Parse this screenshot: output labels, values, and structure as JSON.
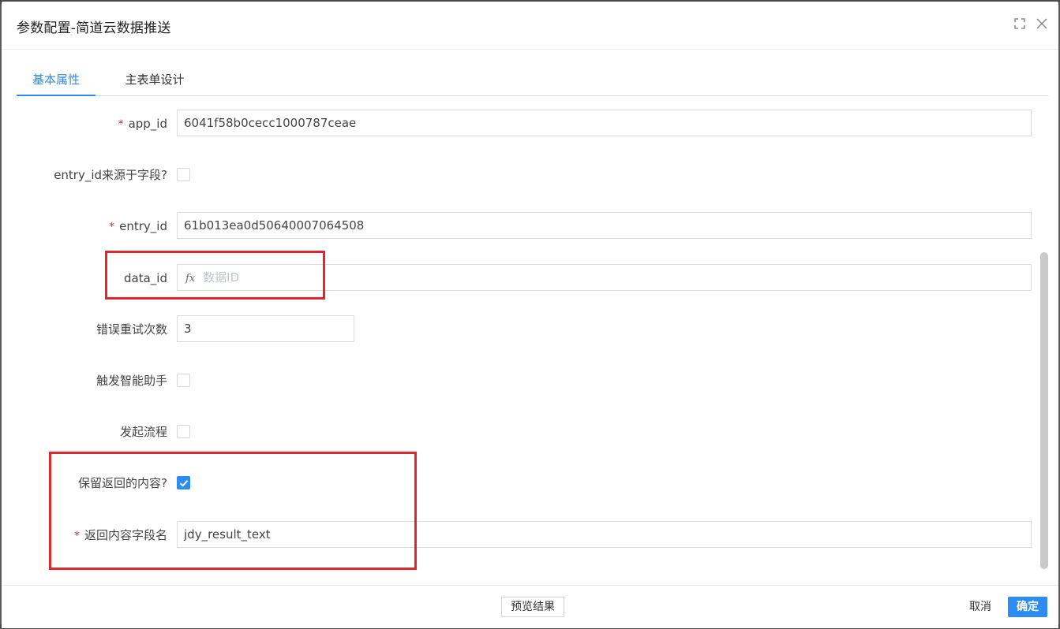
{
  "dialog": {
    "title": "参数配置-简道云数据推送"
  },
  "header_icons": [
    "maximize-icon",
    "close-icon"
  ],
  "tabs": [
    {
      "label": "基本属性",
      "active": true
    },
    {
      "label": "主表单设计",
      "active": false
    }
  ],
  "form": {
    "app_id": {
      "label": "app_id",
      "required": true,
      "value": "6041f58b0cecc1000787ceae"
    },
    "entry_id_from_field": {
      "label": "entry_id来源于字段?",
      "checked": false
    },
    "entry_id": {
      "label": "entry_id",
      "required": true,
      "value": "61b013ea0d50640007064508"
    },
    "data_id": {
      "label": "data_id",
      "fx": "fx",
      "placeholder": "数据ID"
    },
    "retry_count": {
      "label": "错误重试次数",
      "value": "3"
    },
    "trigger_assistant": {
      "label": "触发智能助手",
      "checked": false
    },
    "start_process": {
      "label": "发起流程",
      "checked": false
    },
    "keep_response": {
      "label": "保留返回的内容?",
      "checked": true
    },
    "response_field": {
      "label": "返回内容字段名",
      "required": true,
      "value": "jdy_result_text"
    }
  },
  "footer": {
    "preview": "预览结果",
    "cancel": "取消",
    "ok": "确定"
  },
  "colors": {
    "accent": "#2d8cf0",
    "highlight": "#e3262b",
    "required": "#d9302b"
  }
}
